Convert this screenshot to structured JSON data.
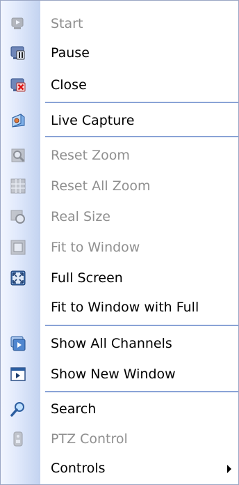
{
  "menu": {
    "items": [
      {
        "label": "Start",
        "icon": "start-icon",
        "enabled": false
      },
      {
        "label": "Pause",
        "icon": "pause-icon",
        "enabled": true
      },
      {
        "label": "Close",
        "icon": "close-icon",
        "enabled": true
      },
      {
        "label": "Live Capture",
        "icon": "live-capture-icon",
        "enabled": true
      },
      {
        "label": "Reset Zoom",
        "icon": "reset-zoom-icon",
        "enabled": false
      },
      {
        "label": "Reset All Zoom",
        "icon": "reset-all-zoom-icon",
        "enabled": false
      },
      {
        "label": "Real Size",
        "icon": "real-size-icon",
        "enabled": false
      },
      {
        "label": "Fit to Window",
        "icon": "fit-to-window-icon",
        "enabled": false
      },
      {
        "label": "Full Screen",
        "icon": "full-screen-icon",
        "enabled": true
      },
      {
        "label": "Fit to Window with Full",
        "icon": "",
        "enabled": true
      },
      {
        "label": "Show All Channels",
        "icon": "show-all-channels-icon",
        "enabled": true
      },
      {
        "label": "Show New Window",
        "icon": "show-new-window-icon",
        "enabled": true
      },
      {
        "label": "Search",
        "icon": "search-icon",
        "enabled": true
      },
      {
        "label": "PTZ Control",
        "icon": "ptz-control-icon",
        "enabled": false
      },
      {
        "label": "Controls",
        "icon": "",
        "enabled": true,
        "submenu": true
      }
    ]
  },
  "colors": {
    "separator": "#8aa3d6",
    "disabled_text": "#8f8f8f",
    "gutter_light": "#f2f6ff",
    "gutter_dark": "#c3d3f0"
  }
}
